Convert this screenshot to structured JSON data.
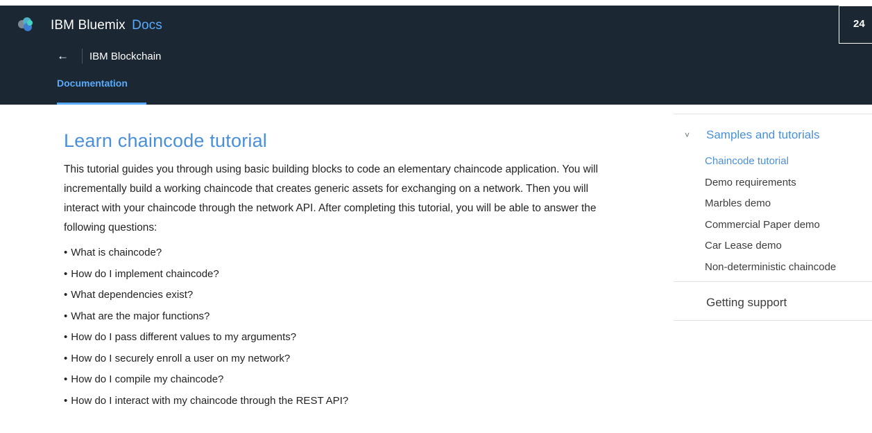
{
  "header": {
    "brand_name": "IBM Bluemix",
    "brand_suffix": "Docs",
    "back_label": "←",
    "product": "IBM Blockchain",
    "tab_label": "Documentation",
    "badge_text": "24",
    "bg_color": "#1b2834",
    "accent_color": "#5aaafa"
  },
  "main": {
    "title": "Learn chaincode tutorial",
    "intro": "This tutorial guides you through using basic building blocks to code an elementary chaincode application. You will incrementally build a working chaincode that creates generic assets for exchanging on a network. Then you will interact with your chaincode through the network API. After completing this tutorial, you will be able to answer the following questions:",
    "questions": [
      "What is chaincode?",
      "How do I implement chaincode?",
      "What dependencies exist?",
      "What are the major functions?",
      "How do I pass different values to my arguments?",
      "How do I securely enroll a user on my network?",
      "How do I compile my chaincode?",
      "How do I interact with my chaincode through the REST API?"
    ]
  },
  "sidebar": {
    "section_icon": "chevron-down-icon",
    "section_title": "Samples and tutorials",
    "items": [
      {
        "label": "Chaincode tutorial",
        "active": true
      },
      {
        "label": "Demo requirements",
        "active": false
      },
      {
        "label": "Marbles demo",
        "active": false
      },
      {
        "label": "Commercial Paper demo",
        "active": false
      },
      {
        "label": "Car Lease demo",
        "active": false
      },
      {
        "label": "Non-deterministic chaincode",
        "active": false
      }
    ],
    "support_label": "Getting support"
  }
}
